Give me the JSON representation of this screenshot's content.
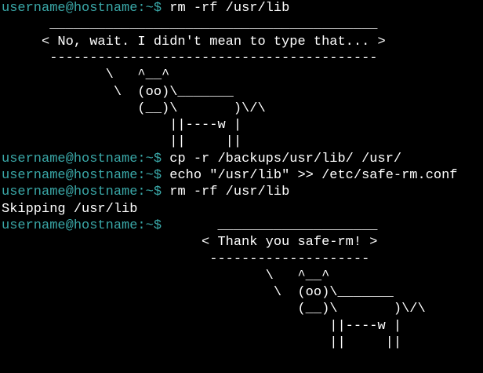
{
  "terminal": {
    "colors": {
      "background": "#000000",
      "prompt": "#3aa8a8",
      "text": "#ffffff"
    },
    "lines": [
      {
        "prompt": "username@hostname:~$",
        "text": " rm -rf /usr/lib"
      },
      {
        "prompt": "",
        "text": "      _________________________________________"
      },
      {
        "prompt": "",
        "text": "     < No, wait. I didn't mean to type that... >"
      },
      {
        "prompt": "",
        "text": "      -----------------------------------------"
      },
      {
        "prompt": "",
        "text": "             \\   ^__^"
      },
      {
        "prompt": "",
        "text": "              \\  (oo)\\_______"
      },
      {
        "prompt": "",
        "text": "                 (__)\\       )\\/\\"
      },
      {
        "prompt": "",
        "text": "                     ||----w |"
      },
      {
        "prompt": "",
        "text": "                     ||     ||"
      },
      {
        "prompt": "username@hostname:~$",
        "text": " cp -r /backups/usr/lib/ /usr/"
      },
      {
        "prompt": "username@hostname:~$",
        "text": " echo \"/usr/lib\" >> /etc/safe-rm.conf"
      },
      {
        "prompt": "username@hostname:~$",
        "text": " rm -rf /usr/lib"
      },
      {
        "prompt": "",
        "text": "Skipping /usr/lib"
      },
      {
        "prompt": "username@hostname:~$",
        "text": "       ____________________"
      },
      {
        "prompt": "",
        "text": "                         < Thank you safe-rm! >"
      },
      {
        "prompt": "",
        "text": "                          --------------------"
      },
      {
        "prompt": "",
        "text": "                                 \\   ^__^"
      },
      {
        "prompt": "",
        "text": "                                  \\  (oo)\\_______"
      },
      {
        "prompt": "",
        "text": "                                     (__)\\       )\\/\\"
      },
      {
        "prompt": "",
        "text": "                                         ||----w |"
      },
      {
        "prompt": "",
        "text": "                                         ||     ||"
      }
    ]
  }
}
